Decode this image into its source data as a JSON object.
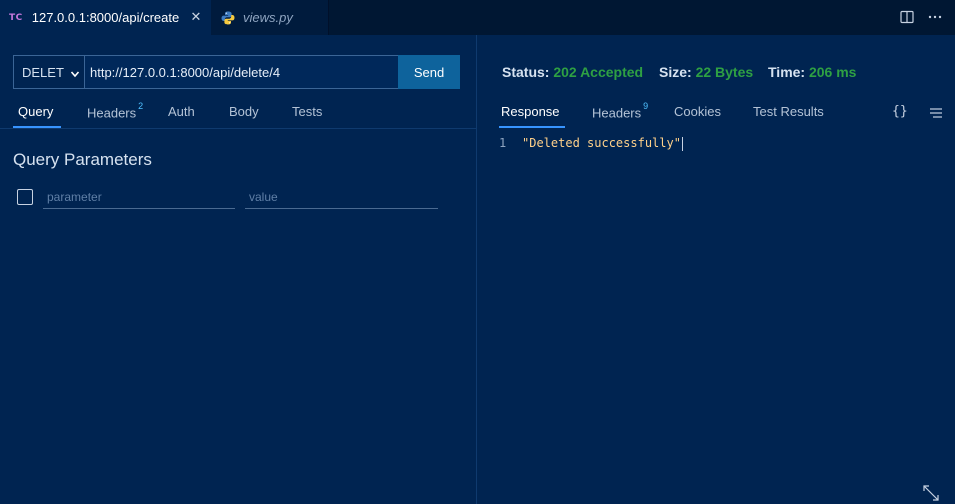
{
  "tabs": [
    {
      "icon": "TC",
      "label": "127.0.0.1:8000/api/create",
      "close": "✕"
    },
    {
      "label": "views.py"
    }
  ],
  "request": {
    "method": "DELETE",
    "url": "http://127.0.0.1:8000/api/delete/4",
    "send_label": "Send",
    "tabs": [
      {
        "label": "Query"
      },
      {
        "label": "Headers",
        "badge": "2"
      },
      {
        "label": "Auth"
      },
      {
        "label": "Body"
      },
      {
        "label": "Tests"
      }
    ],
    "query": {
      "title": "Query Parameters",
      "parameter_placeholder": "parameter",
      "value_placeholder": "value"
    }
  },
  "response": {
    "status_label": "Status:",
    "status_value": "202 Accepted",
    "size_label": "Size:",
    "size_value": "22 Bytes",
    "time_label": "Time:",
    "time_value": "206 ms",
    "tabs": [
      {
        "label": "Response"
      },
      {
        "label": "Headers",
        "badge": "9"
      },
      {
        "label": "Cookies"
      },
      {
        "label": "Test Results"
      }
    ],
    "format_icon": "{}",
    "body_line_number": "1",
    "body_text": "\"Deleted successfully\""
  },
  "colors": {
    "background": "#002451",
    "accent": "#3794ff",
    "success": "#2ea043",
    "send_button": "#0e639c"
  }
}
